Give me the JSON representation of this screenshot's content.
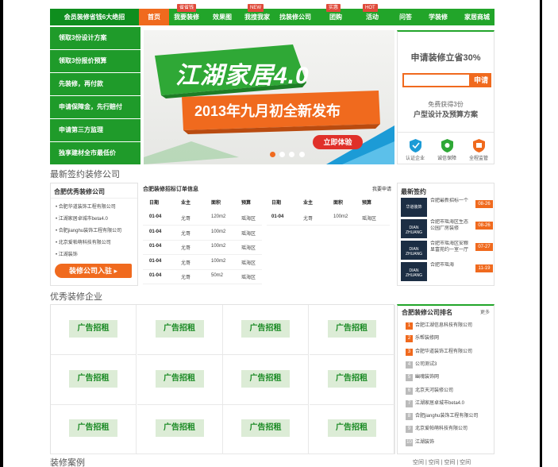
{
  "nav": {
    "promo": "会员装修省钱6大绝招",
    "items": [
      {
        "label": "首页",
        "active": true,
        "tag": ""
      },
      {
        "label": "我要装修",
        "active": false,
        "tag": "省省钱"
      },
      {
        "label": "效果图",
        "active": false,
        "tag": ""
      },
      {
        "label": "我搜我家",
        "active": false,
        "tag": "NEW"
      },
      {
        "label": "找装修公司",
        "active": false,
        "tag": ""
      },
      {
        "label": "团购",
        "active": false,
        "tag": "实惠"
      },
      {
        "label": "活动",
        "active": false,
        "tag": "HOT"
      },
      {
        "label": "问答",
        "active": false,
        "tag": ""
      },
      {
        "label": "学装修",
        "active": false,
        "tag": ""
      },
      {
        "label": "家居商城",
        "active": false,
        "tag": ""
      }
    ]
  },
  "left_menu": [
    "领取3份设计方案",
    "领取3份报价预算",
    "先装修，再付款",
    "申请保障金，先行赔付",
    "申请第三方监理",
    "独享建材全市最低价"
  ],
  "banner": {
    "title": "江湖家居4.0",
    "subtitle": "2013年九月初全新发布",
    "button": "立即体验"
  },
  "apply": {
    "title": "申请装修立省30%",
    "button": "申请",
    "input_placeholder": "",
    "sub1": "免费获得3份",
    "sub2": "户型设计及预算方案"
  },
  "badges": [
    {
      "label": "认证企业",
      "icon": "certified-company-icon"
    },
    {
      "label": "诚信保障",
      "icon": "integrity-shield-icon"
    },
    {
      "label": "全程监管",
      "icon": "supervision-icon"
    }
  ],
  "section_titles": {
    "signed": "最新签约装修公司",
    "excellent": "优秀装修企业",
    "cases": "装修案例"
  },
  "good_companies": {
    "title": "合肥优秀装修公司",
    "items": [
      "合肥华道装饰工程有限公司",
      "江湖家居卓城市beta4.0",
      "合肥jianghu装饰工程有限公司",
      "北京爱帕萌科技有限公司",
      "江湖装饰"
    ],
    "join": "装修公司入驻"
  },
  "bidding": {
    "title": "合肥装修招标订单信息",
    "action": "我要申请",
    "headers": [
      "日期",
      "业主",
      "面积",
      "预算"
    ],
    "left_rows": [
      [
        "01-04",
        "尤哥",
        "120m2",
        "瑶海区"
      ],
      [
        "01-04",
        "尤哥",
        "100m2",
        "瑶海区"
      ],
      [
        "01-04",
        "尤哥",
        "100m2",
        "瑶海区"
      ],
      [
        "01-04",
        "尤哥",
        "100m2",
        "瑶海区"
      ],
      [
        "01-04",
        "尤哥",
        "50m2",
        "瑶海区"
      ]
    ],
    "right_rows": [
      [
        "01-04",
        "尤哥",
        "100m2",
        "瑶海区"
      ]
    ]
  },
  "latest_signed": {
    "title": "最新签约",
    "items": [
      {
        "text": "合肥最新招标一个",
        "date": "08-26",
        "logo": "华道装饰"
      },
      {
        "text": "合肥市瑶海区生态公园厂房装修",
        "date": "08-26",
        "logo": "DIAN ZHUANG"
      },
      {
        "text": "合肥市瑶海区安粮显富苑约一室一厅",
        "date": "07-27",
        "logo": "DIAN ZHUANG"
      },
      {
        "text": "合肥市瑶海",
        "date": "11-19",
        "logo": "DIAN ZHUANG"
      }
    ]
  },
  "ads": {
    "label": "广告招租",
    "count": 12
  },
  "ranking": {
    "title": "合肥装修公司排名",
    "more": "更多",
    "items": [
      "合肥江湖信息科技有限公司",
      "乐帮装修网",
      "合肥华道装饰工程有限公司",
      "公司测试3",
      "幽魂装饰网",
      "北京天河装修公司",
      "江湖家居卓城市beta4.0",
      "合肥jianghu装饰工程有限公司",
      "北京爱帕萌科技有限公司",
      "江湖装饰"
    ]
  },
  "case_links": [
    "空间",
    "空间",
    "空间",
    "空间"
  ],
  "colors": {
    "green": "#22a52a",
    "dark_green": "#1f9b2a",
    "orange": "#f06a1e"
  }
}
